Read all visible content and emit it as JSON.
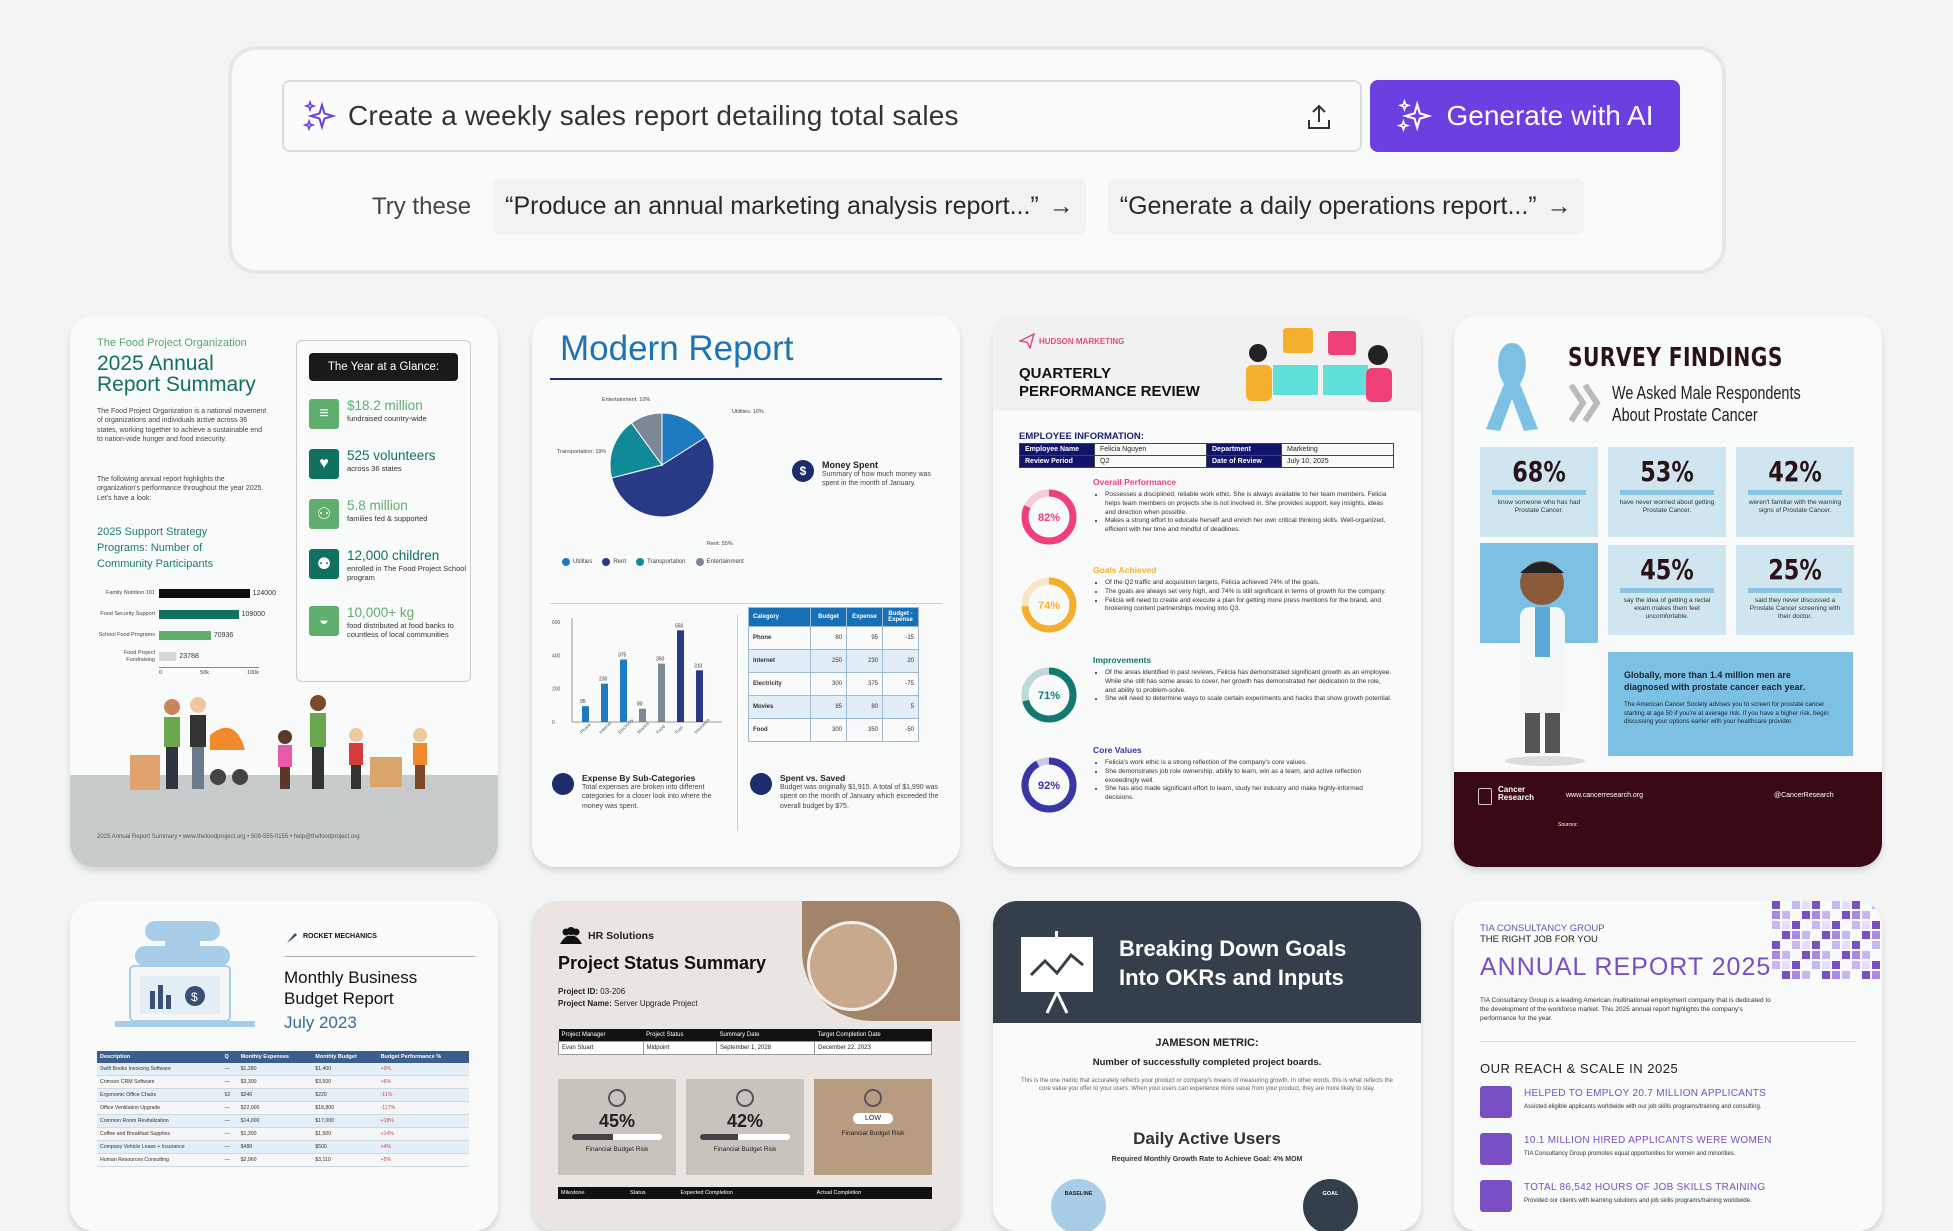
{
  "prompt": {
    "input_value": "Create a weekly sales report detailing total sales",
    "generate_label": "Generate with AI",
    "try_label": "Try these",
    "suggestions": [
      "“Produce an annual marketing analysis report...”",
      "“Generate a daily operations report...”"
    ],
    "accent": "#6b3fe0"
  },
  "templates": {
    "food": {
      "org": "The Food Project Organization",
      "title_line1": "2025 Annual",
      "title_line2": "Report Summary",
      "desc": "The Food Project Organization is a national movement of organizations and individuals active across 36 states, working together to achieve a sustainable end to nation-wide hunger and food insecurity.",
      "desc2": "The following annual report highlights the organization's performance throughout the year 2025. Let's have a look:",
      "program_title": "2025 Support Strategy Programs: Number of Community Participants",
      "glance_title": "The Year at a Glance:",
      "stats": [
        {
          "value": "$18.2 million",
          "sub": "fundraised country-wide"
        },
        {
          "value": "525 volunteers",
          "sub": "across 36 states"
        },
        {
          "value": "5.8 million",
          "sub": "families fed & supported"
        },
        {
          "value": "12,000 children",
          "sub": "enrolled in The Food Project School program"
        },
        {
          "value": "10,000+ kg",
          "sub": "food distributed at food banks to countless of local communities"
        }
      ],
      "chart_data": {
        "type": "bar",
        "orientation": "horizontal",
        "title": "2025 Support Strategy Programs: Number of Community Participants",
        "categories": [
          "Family Nutrition 101",
          "Food Security Support",
          "School Food Programs",
          "Food Project Fundraising"
        ],
        "values": [
          124000,
          109000,
          70936,
          23788
        ],
        "xticks": [
          "0",
          "50k",
          "100k"
        ],
        "xlim": [
          0,
          130000
        ]
      },
      "footer": "2025 Annual Report Summary • www.thefoodproject.org • 509-555-0155 • help@thefoodproject.org"
    },
    "modern": {
      "title": "Modern Report",
      "pie": {
        "type": "pie",
        "labels": [
          "Utilities",
          "Rent",
          "Transportation",
          "Entertainment"
        ],
        "values": [
          16,
          55,
          19,
          10
        ],
        "data_labels": [
          "Utilities: 16%",
          "Rent: 55%",
          "Transportation: 19%",
          "Entertainment: 10%"
        ]
      },
      "money_spent_title": "Money Spent",
      "money_spent_desc": "Summary of how much money was spent in the month of January.",
      "bar": {
        "type": "bar",
        "categories": [
          "Phone",
          "Internet",
          "Electricity",
          "Movies",
          "Food",
          "Fuel",
          "Insurance"
        ],
        "values": [
          95,
          230,
          375,
          80,
          350,
          550,
          310
        ],
        "yticks": [
          "0",
          "200",
          "400",
          "600"
        ],
        "ylim": [
          0,
          600
        ]
      },
      "expense_title": "Expense By Sub-Categories",
      "expense_desc": "Total expenses are broken into different categories for a closer look into where the money was spent.",
      "table_headers": [
        "Category",
        "Budget",
        "Expense",
        "Budget - Expense"
      ],
      "table_rows": [
        [
          "Phone",
          "80",
          "95",
          "-15"
        ],
        [
          "Internet",
          "250",
          "230",
          "20"
        ],
        [
          "Electricity",
          "300",
          "375",
          "-75"
        ],
        [
          "Movies",
          "85",
          "80",
          "5"
        ],
        [
          "Food",
          "300",
          "350",
          "-50"
        ]
      ],
      "saved_title": "Spent vs. Saved",
      "saved_desc": "Budget was originally $1,915. A total of $1,990 was spent on the month of January which exceeded the overall budget by $75."
    },
    "hudson": {
      "brand": "HUDSON MARKETING",
      "title_line1": "QUARTERLY",
      "title_line2": "PERFORMANCE REVIEW",
      "emp_info": "EMPLOYEE INFORMATION:",
      "emp": [
        [
          "Employee Name",
          "Felicia Nguyen",
          "Department",
          "Marketing"
        ],
        [
          "Review Period",
          "Q2",
          "Date of Review",
          "July 10, 2025"
        ]
      ],
      "sections": [
        {
          "pct": 82,
          "label": "82%",
          "title": "Overall Performance",
          "color": "#ef4077",
          "bullets": [
            "Possesses a disciplined, reliable work ethic. She is always available to her team members. Felicia helps team members on projects she is not involved in. She provides support, key insights, ideas and direction when possible.",
            "Makes a strong effort to educate herself and enrich her own critical thinking skills. Well-organized, efficient with her time and mindful of deadlines."
          ]
        },
        {
          "pct": 74,
          "label": "74%",
          "title": "Goals Achieved",
          "color": "#f6ae2d",
          "bullets": [
            "Of the Q2 traffic and acquisition targets, Felicia achieved 74% of the goals.",
            "The goals are always set very high, and 74% is still significant in terms of growth for the company.",
            "Felicia will need to create and execute a plan for getting more press mentions for the brand, and brokering content partnerships moving into Q3."
          ]
        },
        {
          "pct": 71,
          "label": "71%",
          "title": "Improvements",
          "color": "#11796f",
          "bullets": [
            "Of the areas identified in past reviews, Felicia has demonstrated significant growth as an employee. While she still has some areas to cover, her growth has demonstrated her dedication to the role, and ability to problem-solve.",
            "She will need to determine ways to scale certain experiments and hacks that show growth potential."
          ]
        },
        {
          "pct": 92,
          "label": "92%",
          "title": "Core Values",
          "color": "#3a36a6",
          "bullets": [
            "Felicia's work ethic is a strong reflection of the company's core values.",
            "She demonstrates job role ownership, ability to learn, win as a team, and active reflection exceedingly well.",
            "She has also made significant effort to learn, study her industry and make highly-informed decisions."
          ]
        }
      ]
    },
    "survey": {
      "title": "SURVEY FINDINGS",
      "subtitle_line1": "We Asked Male Respondents",
      "subtitle_line2": "About Prostate Cancer",
      "stats": [
        {
          "pct": "68%",
          "desc": "know someone who has had Prostate Cancer."
        },
        {
          "pct": "53%",
          "desc": "have never worried about getting Prostate Cancer."
        },
        {
          "pct": "42%",
          "desc": "weren't familiar with the warning signs of Prostate Cancer."
        },
        {
          "pct": "45%",
          "desc": "say the idea of getting a rectal exam makes them feel uncomfortable."
        },
        {
          "pct": "25%",
          "desc": "said they never discussed a Prostate Cancer screening with their doctor."
        }
      ],
      "fact_title": "Globally, more than 1.4 million men are diagnosed with prostate cancer each year.",
      "fact_desc": "The American Cancer Society advises you to screen for prostate cancer starting at age 50 if you're at average risk. If you have a higher risk, begin discussing your options earlier with your healthcare provider.",
      "org": "Cancer Research",
      "site": "www.cancerresearch.org",
      "handle": "@CancerResearch",
      "sources_label": "Sources:"
    },
    "rocket": {
      "brand": "ROCKET MECHANICS",
      "title_line1": "Monthly Business",
      "title_line2": "Budget Report",
      "date": "July 2023",
      "headers": [
        "Description",
        "Q",
        "Monthly Expenses",
        "Monthly Budget",
        "Budget Performance %"
      ],
      "rows": [
        [
          "Swift Books Invoicing Software",
          "—",
          "$1,280",
          "$1,400",
          "+9%"
        ],
        [
          "Crimson CRM Software",
          "—",
          "$3,300",
          "$3,500",
          "+6%"
        ],
        [
          "Ergonomic Office Chairs",
          "52",
          "$240",
          "$220",
          "-11%"
        ],
        [
          "Office Ventilation Upgrade",
          "—",
          "$22,000",
          "$18,800",
          "-117%"
        ],
        [
          "Common Room Revitalization",
          "—",
          "$14,000",
          "$17,000",
          "+18%"
        ],
        [
          "Coffee and Breakfast Supplies",
          "—",
          "$1,300",
          "$1,500",
          "+14%"
        ],
        [
          "Company Vehicle Lease + Insurance",
          "—",
          "$480",
          "$500",
          "+4%"
        ],
        [
          "Human Resources Consulting",
          "—",
          "$2,960",
          "$3,110",
          "+5%"
        ]
      ]
    },
    "hr": {
      "brand": "HR Solutions",
      "title": "Project Status Summary",
      "project_id_label": "Project ID:",
      "project_id": "03-206",
      "project_name_label": "Project Name:",
      "project_name": "Server Upgrade Project",
      "headers": [
        "Project Manager",
        "Project Status",
        "Summary Date",
        "Target Completion Date"
      ],
      "row": [
        "Evan Stuart",
        "Midpoint",
        "September 1, 2028",
        "December 22, 2023"
      ],
      "risks": [
        {
          "value": "45%",
          "label": "Financial Budget Risk",
          "fraction": 0.45
        },
        {
          "value": "42%",
          "label": "Financial Budget Risk",
          "fraction": 0.42
        },
        {
          "value": "LOW",
          "label": "Financial Budget Risk"
        }
      ],
      "milestone_headers": [
        "Milestone",
        "Status",
        "Expected Completion",
        "Actual Completion"
      ]
    },
    "okr": {
      "title_line1": "Breaking Down Goals",
      "title_line2": "Into OKRs and Inputs",
      "metric_label": "JAMESON METRIC:",
      "metric": "Number of successfully completed project boards.",
      "metric_desc": "This is the one metric that accurately reflects your product or company's means of measuring growth. In other words, this is what reflects the core value you offer to your users. When your users can experience more value from your product, they are more likely to stay.",
      "dau": "Daily Active Users",
      "dau_sub": "Required Monthly Growth Rate to Achieve Goal: 4% MOM",
      "baseline": "BASELINE",
      "goal": "GOAL"
    },
    "tia": {
      "brand": "TIA CONSULTANCY GROUP",
      "tagline": "THE RIGHT JOB FOR YOU",
      "title": "ANNUAL REPORT 2025",
      "desc": "TIA Consultancy Group is a leading American multinational employment company that is dedicated to the development of the workforce market. This 2025 annual report highlights the company's performance for the year.",
      "section": "OUR REACH & SCALE IN 2025",
      "items": [
        {
          "title": "HELPED TO EMPLOY 20.7 MILLION APPLICANTS",
          "desc": "Assisted eligible applicants worldwide with our job skills programs/training and consulting."
        },
        {
          "title": "10.1 MILLION HIRED APPLICANTS WERE WOMEN",
          "desc": "TIA Consultancy Group promotes equal opportunities for women and minorities."
        },
        {
          "title": "TOTAL 86,542 HOURS OF JOB SKILLS TRAINING",
          "desc": "Provided our clients with learning solutions and job skills programs/training worldwide."
        }
      ]
    }
  }
}
